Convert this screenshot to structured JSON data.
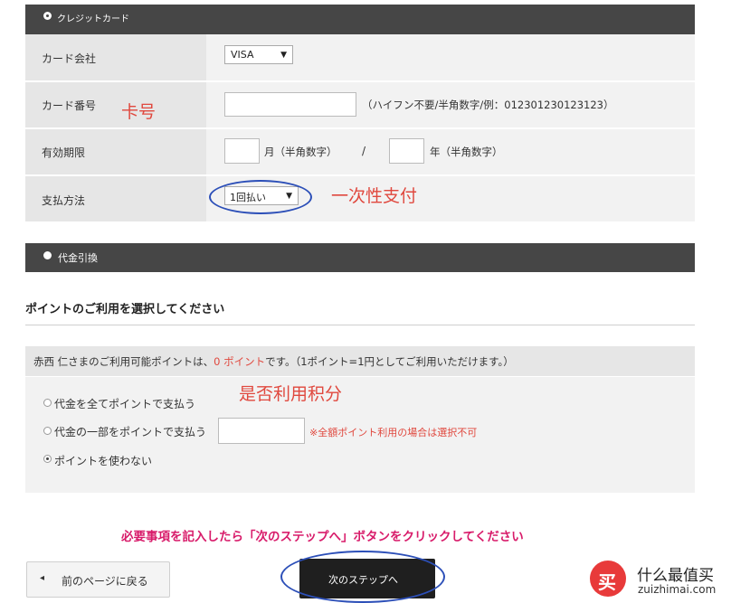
{
  "credit": {
    "title": "クレジットカード",
    "rows": [
      {
        "label": "カード会社",
        "select": "VISA"
      },
      {
        "label": "カード番号",
        "note": "（ハイフン不要/半角数字/例：012301230123123）"
      },
      {
        "label": "有効期限",
        "month_unit": "月（半角数字）",
        "slash": "/",
        "year_unit": "年（半角数字）"
      },
      {
        "label": "支払方法",
        "select": "1回払い"
      }
    ],
    "annotations": {
      "card_no": "卡号",
      "pay_once": "一次性支付"
    }
  },
  "cod": {
    "title": "代金引換"
  },
  "points": {
    "heading": "ポイントのご利用を選択してください",
    "info_prefix": "赤西 仁さまのご利用可能ポイントは、",
    "info_points": "0 ポイント",
    "info_suffix": "です。（1ポイント=1円としてご利用いただけます。）",
    "options": [
      "代金を全てポイントで支払う",
      "代金の一部をポイントで支払う",
      "ポイントを使わない"
    ],
    "note": "※全額ポイント利用の場合は選択不可",
    "annotation": "是否利用积分",
    "selected_option": 2
  },
  "footer": {
    "instruction": "必要事項を記入したら「次のステップへ」ボタンをクリックしてください",
    "prev_arrow": "◂",
    "prev_label": "前のページに戻る",
    "next_label": "次のステップへ"
  },
  "watermark": {
    "logo_char": "买",
    "name": "什么最值买",
    "domain": "zuizhimai.com"
  },
  "colors": {
    "header_bar": "#464646",
    "label_bg": "#e6e6e6",
    "value_bg": "#f2f2f2",
    "accent_red": "#e0483e",
    "circle_blue": "#2c4fb8"
  }
}
